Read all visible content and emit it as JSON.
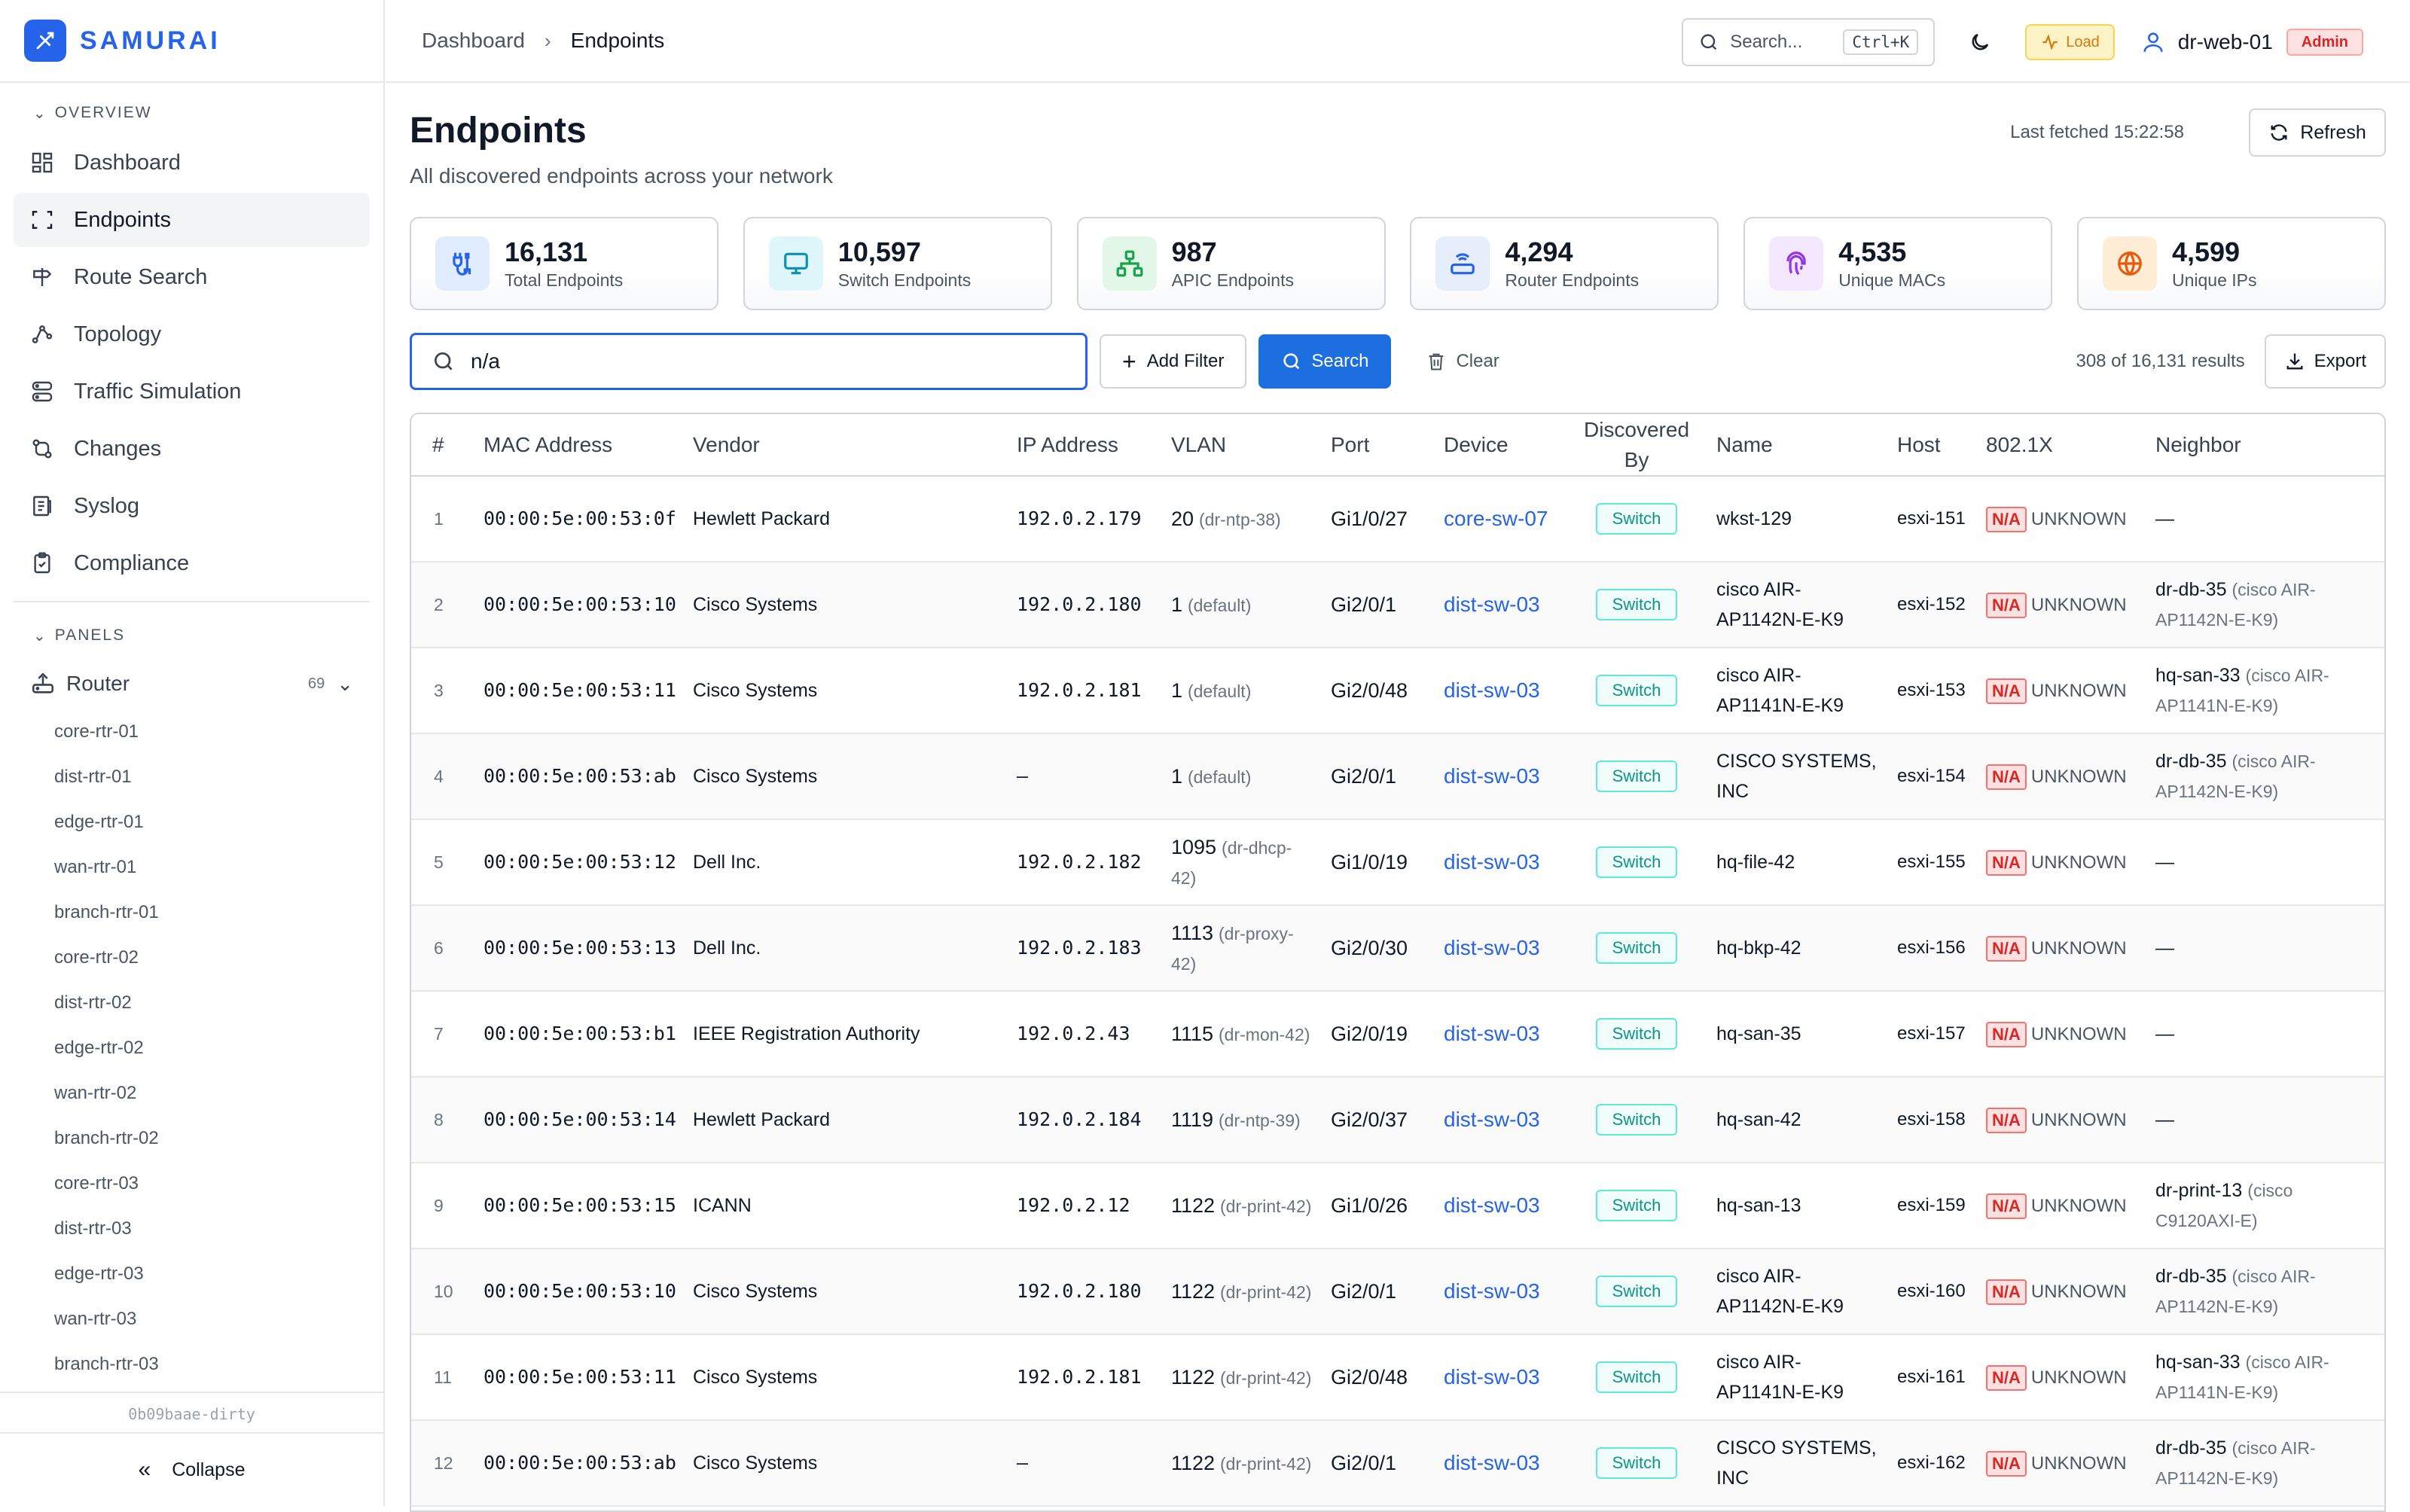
{
  "brand": {
    "name": "SAMURAI"
  },
  "sidebar": {
    "overview_label": "OVERVIEW",
    "nav": [
      {
        "label": "Dashboard",
        "icon": "dashboard-icon"
      },
      {
        "label": "Endpoints",
        "icon": "endpoints-icon"
      },
      {
        "label": "Route Search",
        "icon": "route-icon"
      },
      {
        "label": "Topology",
        "icon": "topology-icon"
      },
      {
        "label": "Traffic Simulation",
        "icon": "traffic-icon"
      },
      {
        "label": "Changes",
        "icon": "changes-icon"
      },
      {
        "label": "Syslog",
        "icon": "syslog-icon"
      },
      {
        "label": "Compliance",
        "icon": "compliance-icon"
      }
    ],
    "panels_label": "PANELS",
    "router": {
      "label": "Router",
      "count": "69"
    },
    "routers": [
      "core-rtr-01",
      "dist-rtr-01",
      "edge-rtr-01",
      "wan-rtr-01",
      "branch-rtr-01",
      "core-rtr-02",
      "dist-rtr-02",
      "edge-rtr-02",
      "wan-rtr-02",
      "branch-rtr-02",
      "core-rtr-03",
      "dist-rtr-03",
      "edge-rtr-03",
      "wan-rtr-03",
      "branch-rtr-03"
    ],
    "version": "0b09baae-dirty",
    "collapse_label": "Collapse"
  },
  "topbar": {
    "crumbs": [
      "Dashboard",
      "Endpoints"
    ],
    "search_placeholder": "Search...",
    "shortcut": "Ctrl+K",
    "load_label": "Load",
    "host": "dr-web-01",
    "role": "Admin"
  },
  "page": {
    "title": "Endpoints",
    "subtitle": "All discovered endpoints across your network",
    "last_fetched": "Last fetched 15:22:58",
    "refresh_label": "Refresh"
  },
  "stats": [
    {
      "value": "16,131",
      "label": "Total Endpoints",
      "color": "#2563eb",
      "bg": "#e0ecff"
    },
    {
      "value": "10,597",
      "label": "Switch Endpoints",
      "color": "#0891b2",
      "bg": "#dff6fb"
    },
    {
      "value": "987",
      "label": "APIC Endpoints",
      "color": "#16a34a",
      "bg": "#e3f7e9"
    },
    {
      "value": "4,294",
      "label": "Router Endpoints",
      "color": "#2563eb",
      "bg": "#e6edfb"
    },
    {
      "value": "4,535",
      "label": "Unique MACs",
      "color": "#9333ea",
      "bg": "#f3e8ff"
    },
    {
      "value": "4,599",
      "label": "Unique IPs",
      "color": "#ea580c",
      "bg": "#ffedd5"
    }
  ],
  "filters": {
    "query": "n/a",
    "add_filter_label": "Add Filter",
    "search_label": "Search",
    "clear_label": "Clear",
    "results": "308 of 16,131 results",
    "export_label": "Export"
  },
  "table": {
    "columns": [
      "#",
      "MAC Address",
      "Vendor",
      "IP Address",
      "VLAN",
      "Port",
      "Device",
      "Discovered By",
      "Name",
      "Host",
      "802.1X",
      "Neighbor"
    ],
    "rows": [
      {
        "n": "1",
        "mac": "00:00:5e:00:53:0f",
        "vendor": "Hewlett Packard",
        "ip": "192.0.2.179",
        "vlan": "20",
        "vlan_name": "(dr-ntp-38)",
        "port": "Gi1/0/27",
        "device": "core-sw-07",
        "by": "Switch",
        "name": "wkst-129",
        "host": "esxi-151",
        "dot1x": "N/A",
        "dot1x_state": "UNKNOWN",
        "nb": "—",
        "nb_model": ""
      },
      {
        "n": "2",
        "mac": "00:00:5e:00:53:10",
        "vendor": "Cisco Systems",
        "ip": "192.0.2.180",
        "vlan": "1",
        "vlan_name": "(default)",
        "port": "Gi2/0/1",
        "device": "dist-sw-03",
        "by": "Switch",
        "name": "cisco AIR-AP1142N-E-K9",
        "host": "esxi-152",
        "dot1x": "N/A",
        "dot1x_state": "UNKNOWN",
        "nb": "dr-db-35",
        "nb_model": "(cisco AIR-AP1142N-E-K9)"
      },
      {
        "n": "3",
        "mac": "00:00:5e:00:53:11",
        "vendor": "Cisco Systems",
        "ip": "192.0.2.181",
        "vlan": "1",
        "vlan_name": "(default)",
        "port": "Gi2/0/48",
        "device": "dist-sw-03",
        "by": "Switch",
        "name": "cisco AIR-AP1141N-E-K9",
        "host": "esxi-153",
        "dot1x": "N/A",
        "dot1x_state": "UNKNOWN",
        "nb": "hq-san-33",
        "nb_model": "(cisco AIR-AP1141N-E-K9)"
      },
      {
        "n": "4",
        "mac": "00:00:5e:00:53:ab",
        "vendor": "Cisco Systems",
        "ip": "—",
        "vlan": "1",
        "vlan_name": "(default)",
        "port": "Gi2/0/1",
        "device": "dist-sw-03",
        "by": "Switch",
        "name": "CISCO SYSTEMS, INC",
        "host": "esxi-154",
        "dot1x": "N/A",
        "dot1x_state": "UNKNOWN",
        "nb": "dr-db-35",
        "nb_model": "(cisco AIR-AP1142N-E-K9)"
      },
      {
        "n": "5",
        "mac": "00:00:5e:00:53:12",
        "vendor": "Dell Inc.",
        "ip": "192.0.2.182",
        "vlan": "1095",
        "vlan_name": "(dr-dhcp-42)",
        "port": "Gi1/0/19",
        "device": "dist-sw-03",
        "by": "Switch",
        "name": "hq-file-42",
        "host": "esxi-155",
        "dot1x": "N/A",
        "dot1x_state": "UNKNOWN",
        "nb": "—",
        "nb_model": ""
      },
      {
        "n": "6",
        "mac": "00:00:5e:00:53:13",
        "vendor": "Dell Inc.",
        "ip": "192.0.2.183",
        "vlan": "1113",
        "vlan_name": "(dr-proxy-42)",
        "port": "Gi2/0/30",
        "device": "dist-sw-03",
        "by": "Switch",
        "name": "hq-bkp-42",
        "host": "esxi-156",
        "dot1x": "N/A",
        "dot1x_state": "UNKNOWN",
        "nb": "—",
        "nb_model": ""
      },
      {
        "n": "7",
        "mac": "00:00:5e:00:53:b1",
        "vendor": "IEEE Registration Authority",
        "ip": "192.0.2.43",
        "vlan": "1115",
        "vlan_name": "(dr-mon-42)",
        "port": "Gi2/0/19",
        "device": "dist-sw-03",
        "by": "Switch",
        "name": "hq-san-35",
        "host": "esxi-157",
        "dot1x": "N/A",
        "dot1x_state": "UNKNOWN",
        "nb": "—",
        "nb_model": ""
      },
      {
        "n": "8",
        "mac": "00:00:5e:00:53:14",
        "vendor": "Hewlett Packard",
        "ip": "192.0.2.184",
        "vlan": "1119",
        "vlan_name": "(dr-ntp-39)",
        "port": "Gi2/0/37",
        "device": "dist-sw-03",
        "by": "Switch",
        "name": "hq-san-42",
        "host": "esxi-158",
        "dot1x": "N/A",
        "dot1x_state": "UNKNOWN",
        "nb": "—",
        "nb_model": ""
      },
      {
        "n": "9",
        "mac": "00:00:5e:00:53:15",
        "vendor": "ICANN",
        "ip": "192.0.2.12",
        "vlan": "1122",
        "vlan_name": "(dr-print-42)",
        "port": "Gi1/0/26",
        "device": "dist-sw-03",
        "by": "Switch",
        "name": "hq-san-13",
        "host": "esxi-159",
        "dot1x": "N/A",
        "dot1x_state": "UNKNOWN",
        "nb": "dr-print-13",
        "nb_model": "(cisco C9120AXI-E)"
      },
      {
        "n": "10",
        "mac": "00:00:5e:00:53:10",
        "vendor": "Cisco Systems",
        "ip": "192.0.2.180",
        "vlan": "1122",
        "vlan_name": "(dr-print-42)",
        "port": "Gi2/0/1",
        "device": "dist-sw-03",
        "by": "Switch",
        "name": "cisco AIR-AP1142N-E-K9",
        "host": "esxi-160",
        "dot1x": "N/A",
        "dot1x_state": "UNKNOWN",
        "nb": "dr-db-35",
        "nb_model": "(cisco AIR-AP1142N-E-K9)"
      },
      {
        "n": "11",
        "mac": "00:00:5e:00:53:11",
        "vendor": "Cisco Systems",
        "ip": "192.0.2.181",
        "vlan": "1122",
        "vlan_name": "(dr-print-42)",
        "port": "Gi2/0/48",
        "device": "dist-sw-03",
        "by": "Switch",
        "name": "cisco AIR-AP1141N-E-K9",
        "host": "esxi-161",
        "dot1x": "N/A",
        "dot1x_state": "UNKNOWN",
        "nb": "hq-san-33",
        "nb_model": "(cisco AIR-AP1141N-E-K9)"
      },
      {
        "n": "12",
        "mac": "00:00:5e:00:53:ab",
        "vendor": "Cisco Systems",
        "ip": "—",
        "vlan": "1122",
        "vlan_name": "(dr-print-42)",
        "port": "Gi2/0/1",
        "device": "dist-sw-03",
        "by": "Switch",
        "name": "CISCO SYSTEMS, INC",
        "host": "esxi-162",
        "dot1x": "N/A",
        "dot1x_state": "UNKNOWN",
        "nb": "dr-db-35",
        "nb_model": "(cisco AIR-AP1142N-E-K9)"
      }
    ]
  }
}
